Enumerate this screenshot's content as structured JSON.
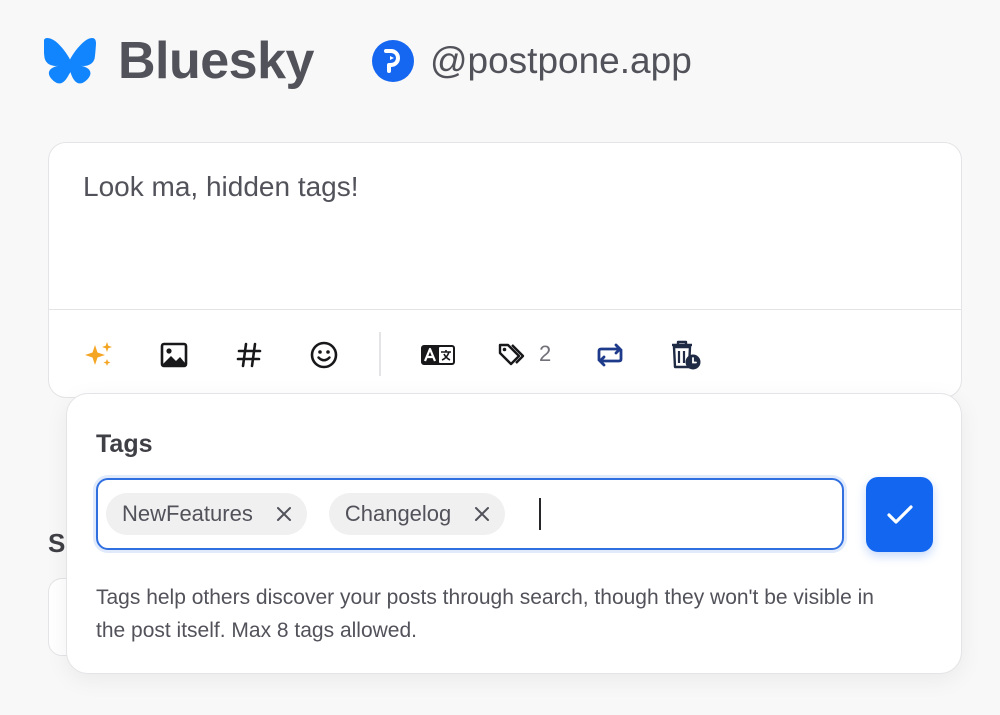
{
  "header": {
    "brand": "Bluesky",
    "handle": "@postpone.app",
    "logo_icon": "butterfly-icon",
    "avatar_icon": "postpone-logo-icon",
    "brand_color": "#1185fe"
  },
  "composer": {
    "text": "Look ma, hidden tags!",
    "toolbar": {
      "icons": [
        "sparkles-icon",
        "image-icon",
        "hashtag-icon",
        "emoji-icon",
        "translate-icon",
        "tags-icon",
        "repost-icon",
        "auto-delete-icon"
      ],
      "tag_count": "2"
    }
  },
  "background": {
    "section_initial": "S"
  },
  "tags_popover": {
    "title": "Tags",
    "tags": [
      {
        "label": "NewFeatures"
      },
      {
        "label": "Changelog"
      }
    ],
    "input_value": "",
    "confirm_icon": "check-icon",
    "help": "Tags help others discover your posts through search, though they won't be visible in the post itself. Max 8 tags allowed.",
    "accent": "#1266f0"
  }
}
